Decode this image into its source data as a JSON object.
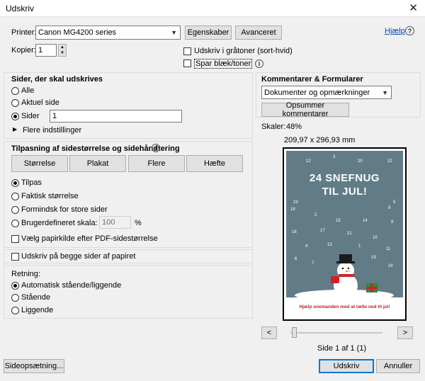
{
  "window": {
    "title": "Udskriv",
    "close_glyph": "✕"
  },
  "help": {
    "label": "Hjælp",
    "icon_glyph": "?"
  },
  "printer": {
    "label": "Printer:",
    "selected": "Canon MG4200 series",
    "properties_button": "Egenskaber",
    "advanced_button": "Avanceret"
  },
  "copies": {
    "label": "Kopier:",
    "value": "1"
  },
  "options": {
    "grayscale_label": "Udskriv i gråtoner (sort-hvid)",
    "grayscale_checked": false,
    "save_ink_label": "Spar blæk/toner",
    "save_ink_checked": false,
    "info_glyph": "i"
  },
  "pages": {
    "header": "Sider, der skal udskrives",
    "all_label": "Alle",
    "current_label": "Aktuel side",
    "pages_label": "Sider",
    "pages_value": "1",
    "selected": "pages",
    "more_settings": "Flere indstillinger"
  },
  "sizing": {
    "header": "Tilpasning af sidestørrelse og sidehåndtering",
    "buttons": [
      "Størrelse",
      "Plakat",
      "Flere",
      "Hæfte"
    ],
    "fit_label": "Tilpas",
    "actual_label": "Faktisk størrelse",
    "shrink_label": "Formindsk for store sider",
    "custom_label": "Brugerdefineret skala:",
    "custom_value": "100",
    "percent": "%",
    "paper_source_label": "Vælg papirkilde efter PDF-sidestørrelse",
    "selected": "fit"
  },
  "duplex": {
    "label": "Udskriv på begge sider af papiret",
    "checked": false
  },
  "orientation": {
    "header": "Retning:",
    "auto_label": "Automatisk stående/liggende",
    "portrait_label": "Stående",
    "landscape_label": "Liggende",
    "selected": "auto"
  },
  "comments": {
    "header": "Kommentarer & Formularer",
    "selected": "Dokumenter og opmærkninger",
    "summarize_button": "Opsummer kommentarer"
  },
  "preview": {
    "scale_label": "Skaler:",
    "scale_value": "48%",
    "page_size": "209,97 x 296,93 mm",
    "poster_title_1": "24 SNEFNUG",
    "poster_title_2": "TIL JUL!",
    "numbers": [
      "12",
      "3",
      "20",
      "22",
      "23",
      "5",
      "18",
      "9",
      "2",
      "15",
      "14",
      "8",
      "16",
      "17",
      "21",
      "10",
      "4",
      "13",
      "1",
      "11",
      "6",
      "7",
      "19",
      "24"
    ],
    "footer_text": "Hjælp snemanden med at tælle ned til jul!",
    "prev_glyph": "<",
    "next_glyph": ">",
    "page_indicator": "Side 1 af 1 (1)"
  },
  "footer": {
    "page_setup_button": "Sideopsætning...",
    "print_button": "Udskriv",
    "cancel_button": "Annuller"
  },
  "colors": {
    "poster_bg": "#617c87",
    "primary_border": "#0078d7"
  }
}
